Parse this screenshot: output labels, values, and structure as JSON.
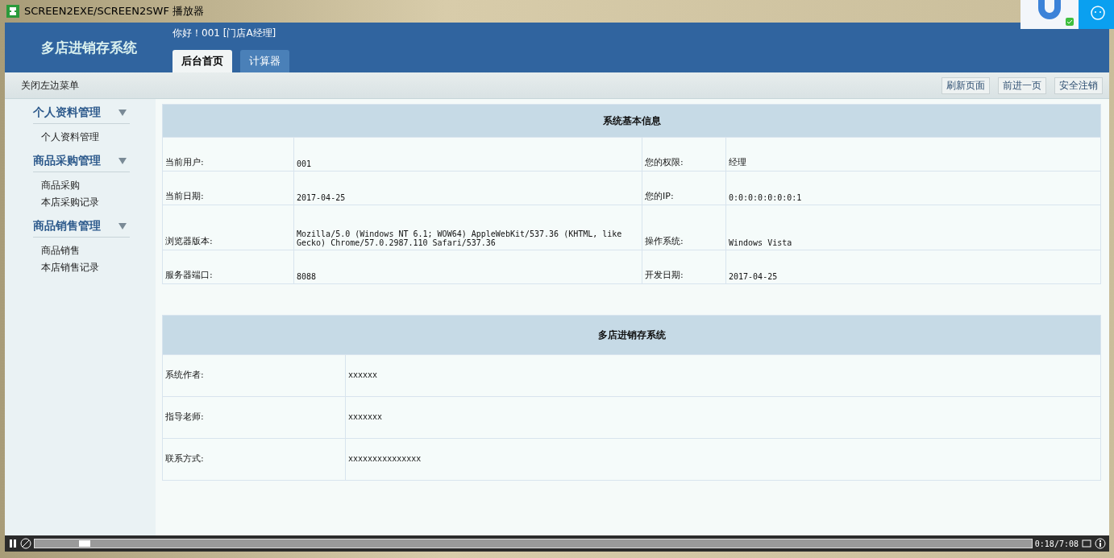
{
  "window": {
    "title": "SCREEN2EXE/SCREEN2SWF 播放器"
  },
  "header": {
    "brand": "多店进销存系统",
    "greeting": "你好！001 [门店A经理]",
    "tabs": [
      {
        "label": "后台首页",
        "selected": true
      },
      {
        "label": "计算器",
        "selected": false
      }
    ]
  },
  "toolbar": {
    "toggle": "关闭左边菜单",
    "buttons": [
      "刷新页面",
      "前进一页",
      "安全注销"
    ]
  },
  "sidebar": {
    "groups": [
      {
        "title": "个人资料管理",
        "expanded": true,
        "items": [
          "个人资料管理"
        ]
      },
      {
        "title": "商品采购管理",
        "expanded": true,
        "items": [
          "商品采购",
          "本店采购记录"
        ]
      },
      {
        "title": "商品销售管理",
        "expanded": true,
        "items": [
          "商品销售",
          "本店销售记录"
        ]
      }
    ]
  },
  "info_table": {
    "title": "系统基本信息",
    "rows": [
      [
        "当前用户:",
        "001",
        "您的权限:",
        "经理"
      ],
      [
        "当前日期:",
        "2017-04-25",
        "您的IP:",
        "0:0:0:0:0:0:0:1"
      ],
      [
        "浏览器版本:",
        "Mozilla/5.0 (Windows NT 6.1; WOW64) AppleWebKit/537.36 (KHTML, like Gecko) Chrome/57.0.2987.110 Safari/537.36",
        "操作系统:",
        "Windows Vista"
      ],
      [
        "服务器端口:",
        "8088",
        "开发日期:",
        "2017-04-25"
      ]
    ]
  },
  "about_table": {
    "title": "多店进销存系统",
    "rows": [
      [
        "系统作者:",
        "xxxxxx"
      ],
      [
        "指导老师:",
        "xxxxxxx"
      ],
      [
        "联系方式:",
        "xxxxxxxxxxxxxxx"
      ]
    ]
  },
  "player": {
    "level": 0.05,
    "time": "0:18/7:08"
  }
}
